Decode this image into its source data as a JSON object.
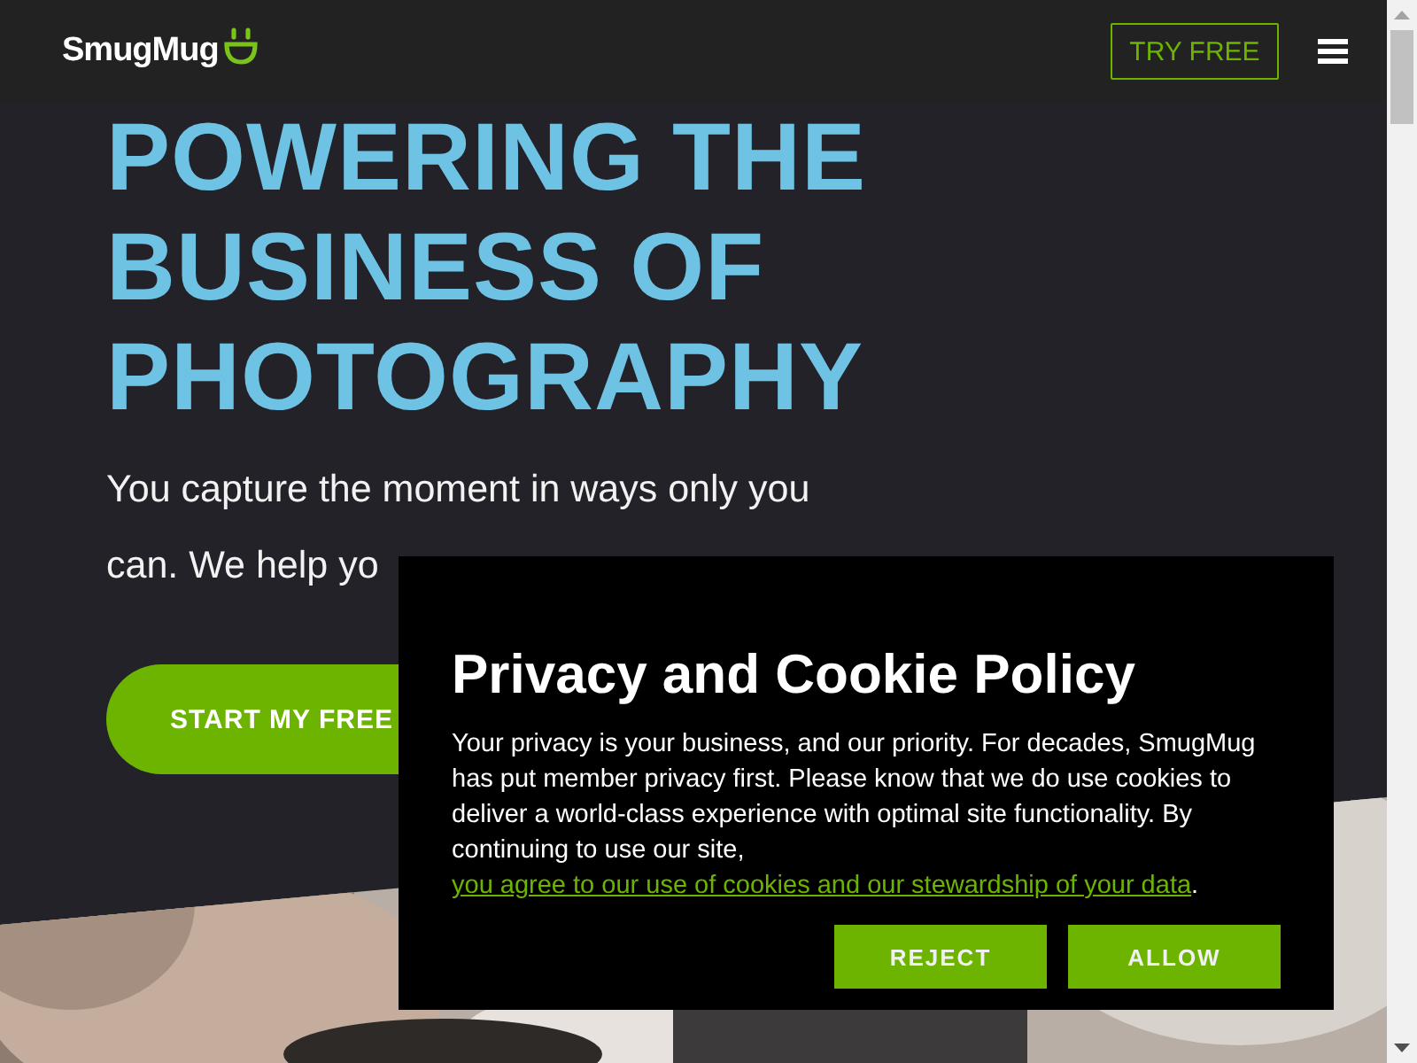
{
  "header": {
    "logo": "SmugMug",
    "try_button": "TRY FREE"
  },
  "hero": {
    "headline_lines": [
      "POWERING THE",
      "BUSINESS OF",
      "PHOTOGRAPHY"
    ],
    "subtitle_lines": [
      "You capture the moment in ways only you",
      "can. We help yo"
    ],
    "cta": "START MY FREE"
  },
  "cookie_dialog": {
    "title": "Privacy and Cookie Policy",
    "text": "Your privacy is your business, and our priority. For decades, SmugMug has put member privacy first. Please know that we do use cookies to deliver a world-class experience with optimal site functionality. By continuing to use our site, ",
    "link": "you agree to our use of cookies and our stewardship of your data",
    "after_link": ".",
    "buttons": [
      "REJECT",
      "ALLOW"
    ]
  }
}
